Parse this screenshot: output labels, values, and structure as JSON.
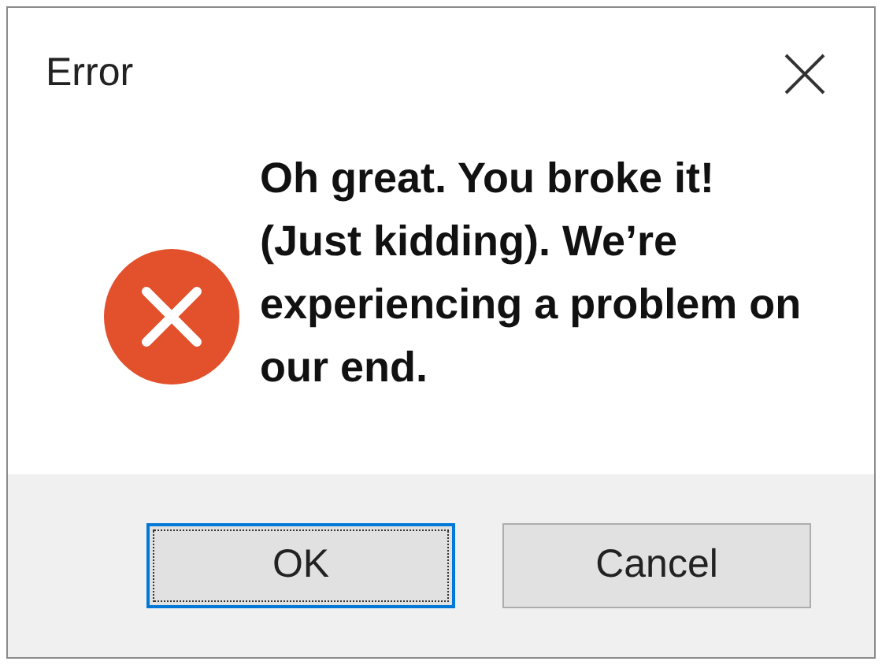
{
  "window": {
    "title": "Error"
  },
  "message": "Oh great. You broke it! (Just kidding). We’re experiencing a problem on our end.",
  "buttons": [
    {
      "label": "OK",
      "selected": true
    },
    {
      "label": "Cancel",
      "selected": false
    }
  ]
}
